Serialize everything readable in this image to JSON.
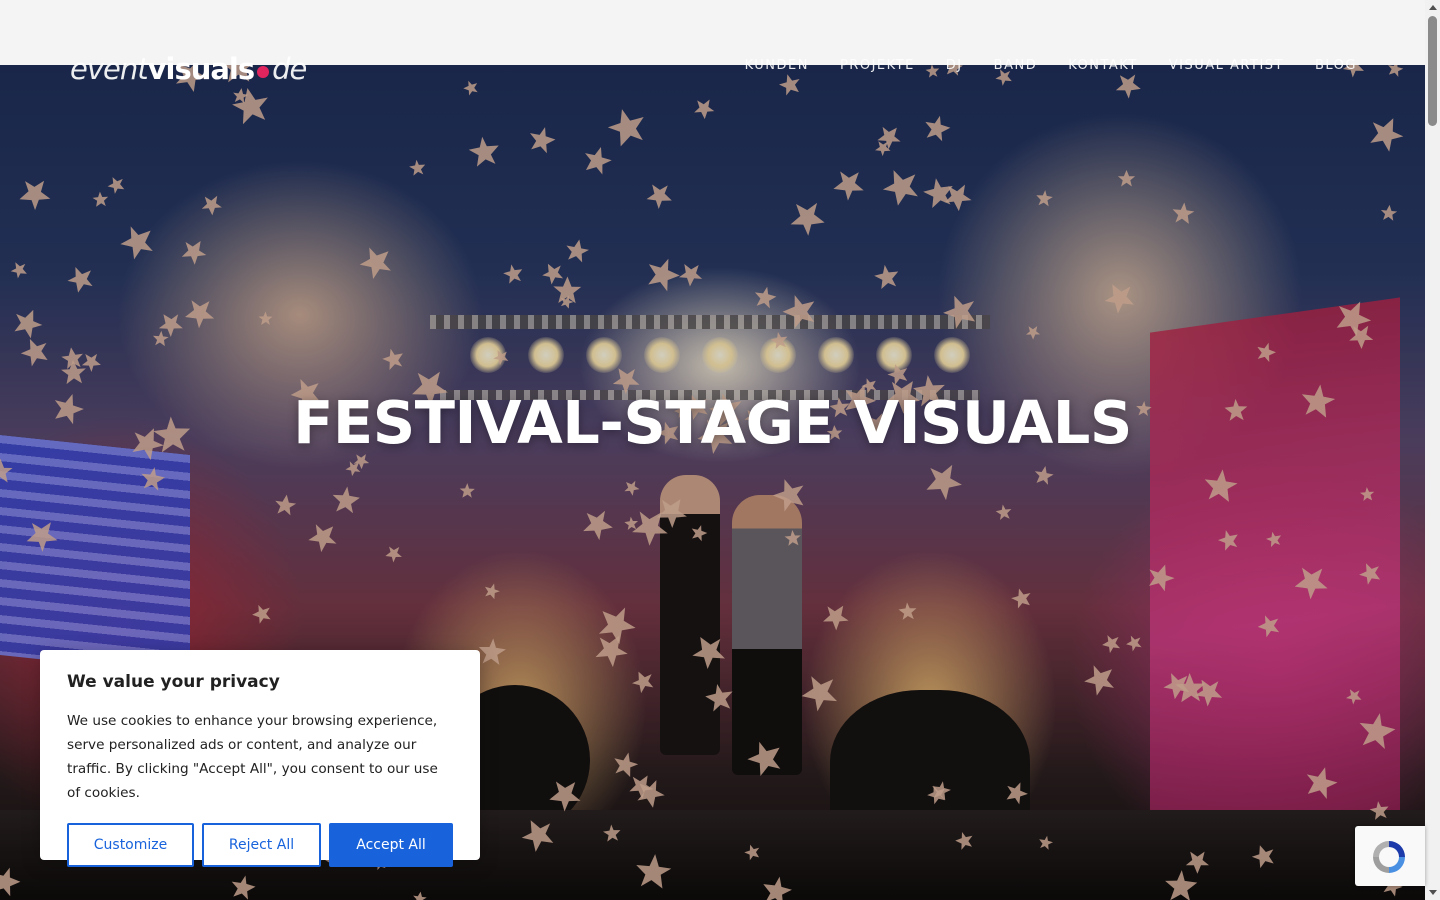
{
  "header": {
    "logo": {
      "part1": "event",
      "part2": "visuals",
      "part3": "de",
      "dot_color": "#e0245e"
    },
    "nav": [
      {
        "label": "KUNDEN"
      },
      {
        "label": "PROJEKTE"
      },
      {
        "label": "DJ"
      },
      {
        "label": "BAND"
      },
      {
        "label": "KONTAKT"
      },
      {
        "label": "VISUAL ARTIST"
      },
      {
        "label": "BLOG"
      }
    ]
  },
  "hero": {
    "title": "FESTIVAL-STAGE VISUALS"
  },
  "cookie_banner": {
    "title": "We value your privacy",
    "text": "We use cookies to enhance your browsing experience, serve personalized ads or content, and analyze our traffic. By clicking \"Accept All\", you consent to our use of cookies.",
    "customize_label": "Customize",
    "reject_label": "Reject All",
    "accept_label": "Accept All",
    "accent_color": "#1863dc"
  },
  "recaptcha": {
    "icon": "recaptcha-icon"
  }
}
